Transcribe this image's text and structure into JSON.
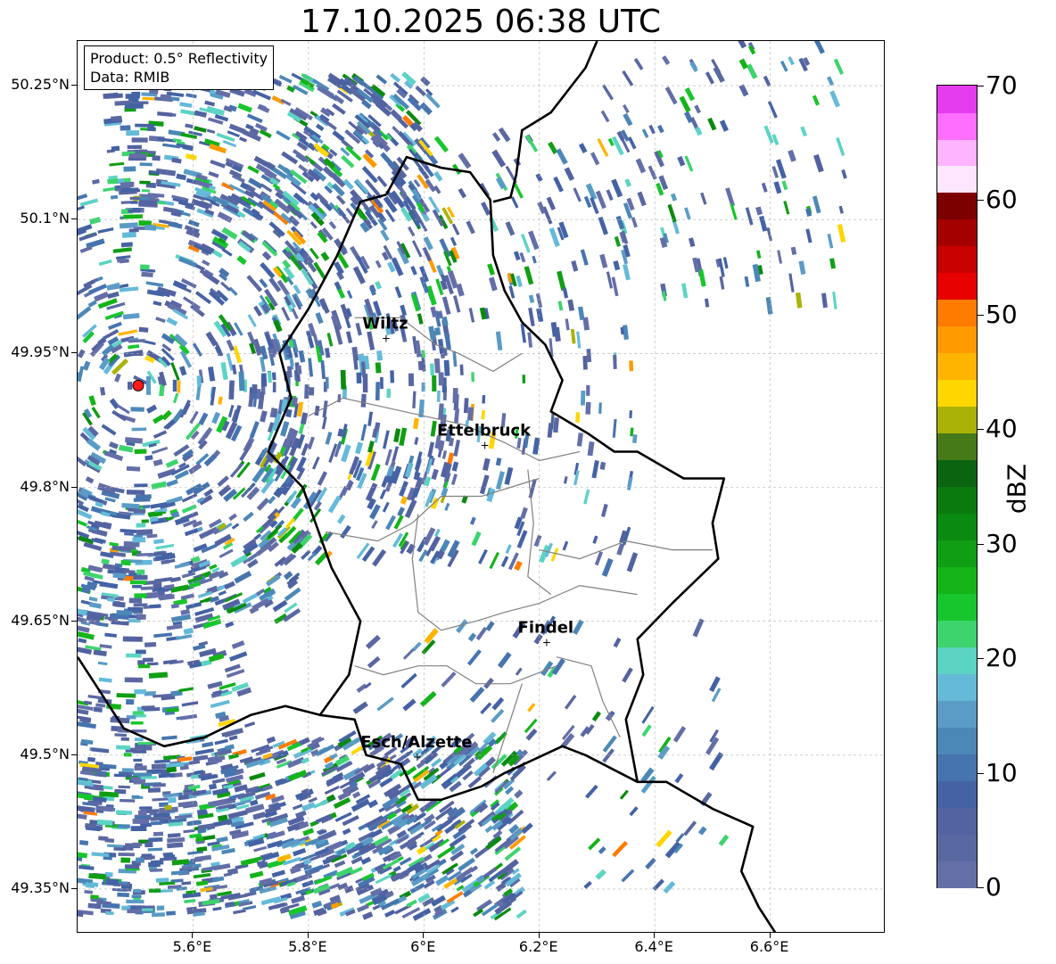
{
  "title": "17.10.2025 06:38 UTC",
  "infobox": {
    "product": "Product: 0.5° Reflectivity",
    "data": "Data: RMIB"
  },
  "map": {
    "lon_range": [
      5.4,
      6.8
    ],
    "lat_range": [
      49.3,
      50.3
    ],
    "lat_ticks": [
      {
        "value": 49.35,
        "label": "49.35°N"
      },
      {
        "value": 49.5,
        "label": "49.5°N"
      },
      {
        "value": 49.65,
        "label": "49.65°N"
      },
      {
        "value": 49.8,
        "label": "49.8°N"
      },
      {
        "value": 49.95,
        "label": "49.95°N"
      },
      {
        "value": 50.1,
        "label": "50.1°N"
      },
      {
        "value": 50.25,
        "label": "50.25°N"
      }
    ],
    "lon_ticks": [
      {
        "value": 5.6,
        "label": "5.6°E"
      },
      {
        "value": 5.8,
        "label": "5.8°E"
      },
      {
        "value": 6.0,
        "label": "6°E"
      },
      {
        "value": 6.2,
        "label": "6.2°E"
      },
      {
        "value": 6.4,
        "label": "6.4°E"
      },
      {
        "value": 6.6,
        "label": "6.6°E"
      }
    ],
    "radar_site": {
      "lon": 5.505,
      "lat": 49.914,
      "color": "#ff1a1a"
    },
    "cities": [
      {
        "name": "Wiltz",
        "lon": 5.933,
        "lat": 49.968
      },
      {
        "name": "Ettelbruck",
        "lon": 6.104,
        "lat": 49.848
      },
      {
        "name": "Findel",
        "lon": 6.211,
        "lat": 49.627
      },
      {
        "name": "Esch/Alzette",
        "lon": 5.987,
        "lat": 49.499
      }
    ],
    "luxembourg_border": [
      [
        5.935,
        50.128
      ],
      [
        5.97,
        50.17
      ],
      [
        6.03,
        50.158
      ],
      [
        6.08,
        50.153
      ],
      [
        6.115,
        50.122
      ],
      [
        6.12,
        50.06
      ],
      [
        6.14,
        50.02
      ],
      [
        6.17,
        49.985
      ],
      [
        6.21,
        49.96
      ],
      [
        6.24,
        49.92
      ],
      [
        6.22,
        49.885
      ],
      [
        6.285,
        49.86
      ],
      [
        6.33,
        49.84
      ],
      [
        6.37,
        49.84
      ],
      [
        6.45,
        49.81
      ],
      [
        6.52,
        49.81
      ],
      [
        6.5,
        49.76
      ],
      [
        6.51,
        49.72
      ],
      [
        6.43,
        49.67
      ],
      [
        6.37,
        49.63
      ],
      [
        6.38,
        49.59
      ],
      [
        6.35,
        49.54
      ],
      [
        6.37,
        49.47
      ],
      [
        6.28,
        49.5
      ],
      [
        6.24,
        49.51
      ],
      [
        6.14,
        49.48
      ],
      [
        6.1,
        49.465
      ],
      [
        6.03,
        49.45
      ],
      [
        5.99,
        49.45
      ],
      [
        5.96,
        49.49
      ],
      [
        5.9,
        49.5
      ],
      [
        5.88,
        49.54
      ],
      [
        5.82,
        49.545
      ],
      [
        5.87,
        49.59
      ],
      [
        5.89,
        49.65
      ],
      [
        5.84,
        49.71
      ],
      [
        5.79,
        49.8
      ],
      [
        5.73,
        49.84
      ],
      [
        5.77,
        49.9
      ],
      [
        5.75,
        49.95
      ],
      [
        5.8,
        50.0
      ],
      [
        5.85,
        50.06
      ],
      [
        5.89,
        50.12
      ],
      [
        5.935,
        50.128
      ]
    ],
    "belgium_germany_border": [
      [
        6.3,
        50.3
      ],
      [
        6.28,
        50.27
      ],
      [
        6.22,
        50.22
      ],
      [
        6.17,
        50.2
      ],
      [
        6.16,
        50.15
      ],
      [
        6.15,
        50.125
      ],
      [
        6.12,
        50.12
      ]
    ],
    "france_luxembourg_west_border": [
      [
        5.4,
        49.61
      ],
      [
        5.45,
        49.56
      ],
      [
        5.48,
        49.53
      ],
      [
        5.55,
        49.51
      ],
      [
        5.62,
        49.52
      ],
      [
        5.7,
        49.545
      ],
      [
        5.76,
        49.555
      ],
      [
        5.82,
        49.545
      ]
    ],
    "germany_france_border": [
      [
        6.37,
        49.47
      ],
      [
        6.42,
        49.47
      ],
      [
        6.5,
        49.44
      ],
      [
        6.57,
        49.42
      ],
      [
        6.55,
        49.37
      ],
      [
        6.58,
        49.33
      ],
      [
        6.61,
        49.3
      ]
    ],
    "cantons": [
      [
        [
          5.88,
          49.99
        ],
        [
          5.96,
          49.99
        ],
        [
          6.02,
          49.96
        ],
        [
          6.06,
          49.95
        ],
        [
          6.12,
          49.93
        ],
        [
          6.17,
          49.95
        ]
      ],
      [
        [
          5.8,
          49.88
        ],
        [
          5.86,
          49.9
        ],
        [
          5.93,
          49.89
        ],
        [
          6.0,
          49.88
        ],
        [
          6.07,
          49.87
        ],
        [
          6.14,
          49.85
        ],
        [
          6.2,
          49.83
        ],
        [
          6.27,
          49.84
        ]
      ],
      [
        [
          5.83,
          49.75
        ],
        [
          5.92,
          49.74
        ],
        [
          5.98,
          49.76
        ],
        [
          6.03,
          49.79
        ],
        [
          6.1,
          49.79
        ],
        [
          6.15,
          49.8
        ],
        [
          6.2,
          49.81
        ]
      ],
      [
        [
          5.99,
          49.77
        ],
        [
          5.98,
          49.72
        ],
        [
          5.99,
          49.66
        ],
        [
          6.03,
          49.64
        ],
        [
          6.09,
          49.65
        ],
        [
          6.14,
          49.66
        ],
        [
          6.2,
          49.67
        ],
        [
          6.27,
          49.69
        ],
        [
          6.37,
          49.68
        ]
      ],
      [
        [
          6.18,
          49.82
        ],
        [
          6.19,
          49.76
        ],
        [
          6.18,
          49.7
        ],
        [
          6.22,
          49.68
        ]
      ],
      [
        [
          5.88,
          49.6
        ],
        [
          5.93,
          49.59
        ],
        [
          5.99,
          49.6
        ],
        [
          6.04,
          49.6
        ],
        [
          6.09,
          49.58
        ],
        [
          6.15,
          49.58
        ],
        [
          6.23,
          49.6
        ]
      ],
      [
        [
          6.23,
          49.61
        ],
        [
          6.29,
          49.6
        ],
        [
          6.31,
          49.56
        ],
        [
          6.34,
          49.52
        ]
      ],
      [
        [
          6.12,
          49.48
        ],
        [
          6.15,
          49.54
        ],
        [
          6.17,
          49.58
        ]
      ],
      [
        [
          6.2,
          49.73
        ],
        [
          6.27,
          49.72
        ],
        [
          6.35,
          49.74
        ],
        [
          6.43,
          49.73
        ],
        [
          6.5,
          49.73
        ]
      ]
    ]
  },
  "colorbar": {
    "label": "dBZ",
    "min": 0,
    "max": 70,
    "tick_values": [
      0,
      10,
      20,
      30,
      40,
      50,
      60,
      70
    ],
    "tick_labels": [
      "0",
      "10",
      "20",
      "30",
      "40",
      "50",
      "60",
      "70"
    ],
    "colors": [
      "#646fa8",
      "#5a68a2",
      "#5362a0",
      "#4462a4",
      "#4674ae",
      "#4b88b8",
      "#5a9cc6",
      "#64bad8",
      "#5cd4c4",
      "#3dd46e",
      "#17c62c",
      "#14b419",
      "#109e14",
      "#0a8a10",
      "#0a7a0e",
      "#0a6410",
      "#467a18",
      "#aab208",
      "#ffd600",
      "#ffb400",
      "#ff9a00",
      "#ff7c00",
      "#e60000",
      "#c80000",
      "#a50000",
      "#7d0000",
      "#ffe6ff",
      "#ffb4ff",
      "#ff6eff",
      "#e63cf0"
    ]
  }
}
